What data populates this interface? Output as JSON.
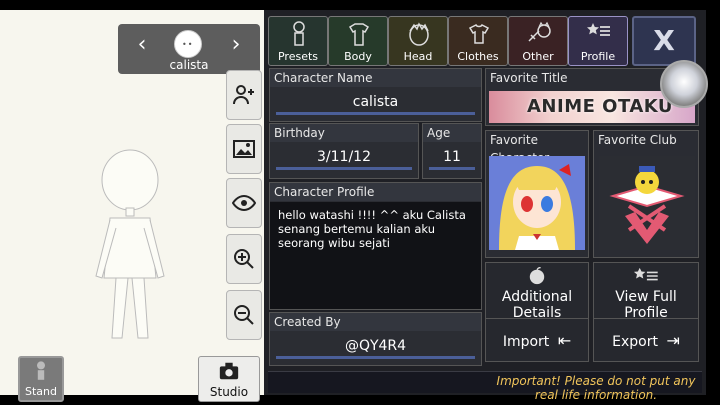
{
  "character_nav": {
    "name": "calista",
    "prev_icon": "chevron-left-icon",
    "next_icon": "chevron-right-icon"
  },
  "side_tools": [
    {
      "name": "add-person-icon"
    },
    {
      "name": "image-icon"
    },
    {
      "name": "eye-icon"
    },
    {
      "name": "zoom-in-icon"
    },
    {
      "name": "zoom-out-icon"
    }
  ],
  "bottom_left": {
    "stand_label": "Stand",
    "studio_label": "Studio"
  },
  "tabs": [
    {
      "label": "Presets",
      "icon": "presets-icon"
    },
    {
      "label": "Body",
      "icon": "body-icon"
    },
    {
      "label": "Head",
      "icon": "head-icon"
    },
    {
      "label": "Clothes",
      "icon": "clothes-icon"
    },
    {
      "label": "Other",
      "icon": "other-icon"
    },
    {
      "label": "Profile",
      "icon": "profile-icon"
    }
  ],
  "close_label": "X",
  "profile": {
    "character_name_label": "Character Name",
    "character_name": "calista",
    "birthday_label": "Birthday",
    "birthday": "3/11/12",
    "age_label": "Age",
    "age": "11",
    "character_profile_label": "Character Profile",
    "character_profile": "hello watashi !!!! ^^  aku Calista senang bertemu kalian aku seorang wibu sejati",
    "created_by_label": "Created By",
    "created_by": "@QY4R4"
  },
  "favorites": {
    "title_label": "Favorite Title",
    "title_text": "ANIME OTAKU",
    "character_label": "Favorite Character",
    "club_label": "Favorite Club"
  },
  "actions": {
    "additional_details": "Additional Details",
    "view_full_profile": "View Full Profile",
    "import": "Import",
    "export": "Export"
  },
  "warning": "Important! Please do not put any real life information.",
  "colors": {
    "panel_bg": "#1f2025",
    "accent_underline": "#4b5f99",
    "warning_text": "#f1c55b"
  }
}
